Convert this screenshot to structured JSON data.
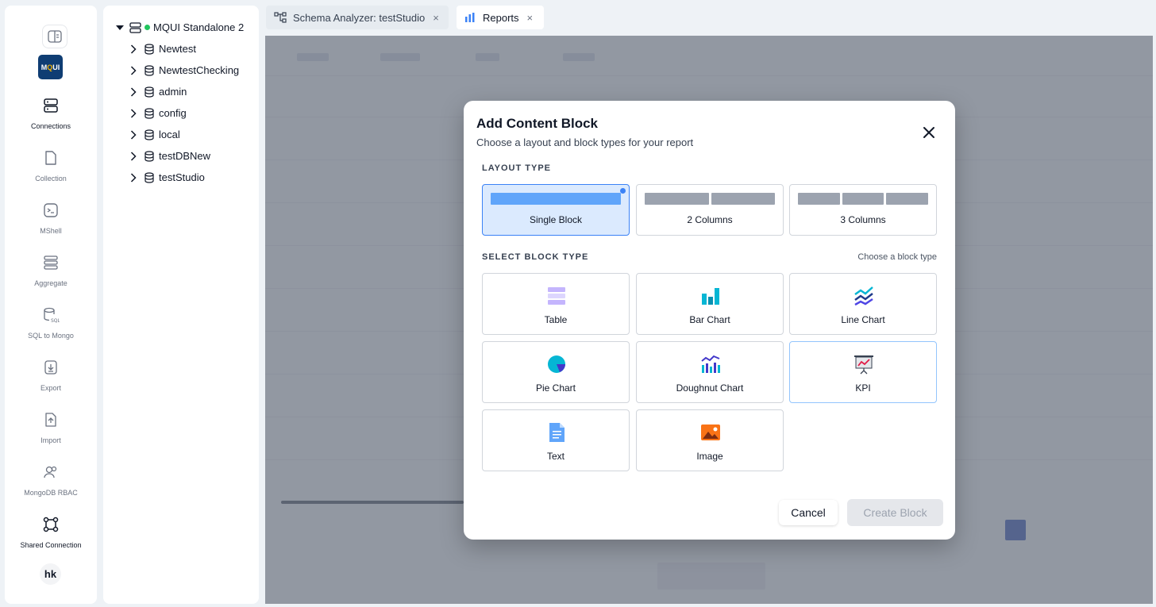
{
  "rail": {
    "items": [
      {
        "label": "Connections",
        "icon": "server-icon"
      },
      {
        "label": "Collection",
        "icon": "document-icon"
      },
      {
        "label": "MShell",
        "icon": "terminal-icon"
      },
      {
        "label": "Aggregate",
        "icon": "stack-icon"
      },
      {
        "label": "SQL to Mongo",
        "icon": "sql-database-icon"
      },
      {
        "label": "Export",
        "icon": "export-icon"
      },
      {
        "label": "Import",
        "icon": "import-icon"
      },
      {
        "label": "MongoDB RBAC",
        "icon": "users-icon"
      },
      {
        "label": "Shared Connection",
        "icon": "share-nodes-icon"
      }
    ],
    "logo_text": "MQUI",
    "avatar": "hk"
  },
  "tree": {
    "root": "MQUI Standalone 2",
    "databases": [
      "Newtest",
      "NewtestChecking",
      "admin",
      "config",
      "local",
      "testDBNew",
      "testStudio"
    ]
  },
  "tabs": [
    {
      "label": "Schema Analyzer: testStudio",
      "close": "×"
    },
    {
      "label": "Reports",
      "close": "×"
    }
  ],
  "modal": {
    "title": "Add Content Block",
    "subtitle": "Choose a layout and block types for your report",
    "layout_label": "LAYOUT TYPE",
    "layouts": [
      "Single Block",
      "2 Columns",
      "3 Columns"
    ],
    "selected_layout": "Single Block",
    "block_label": "SELECT BLOCK TYPE",
    "block_hint": "Choose a block type",
    "blocks": [
      "Table",
      "Bar Chart",
      "Line Chart",
      "Pie Chart",
      "Doughnut Chart",
      "KPI",
      "Text",
      "Image"
    ],
    "cancel": "Cancel",
    "create": "Create Block"
  },
  "colors": {
    "accent": "#3b82f6",
    "selected_bg": "#dbeafe",
    "status_green": "#22c55e",
    "logo_bg": "#0f3d73"
  }
}
